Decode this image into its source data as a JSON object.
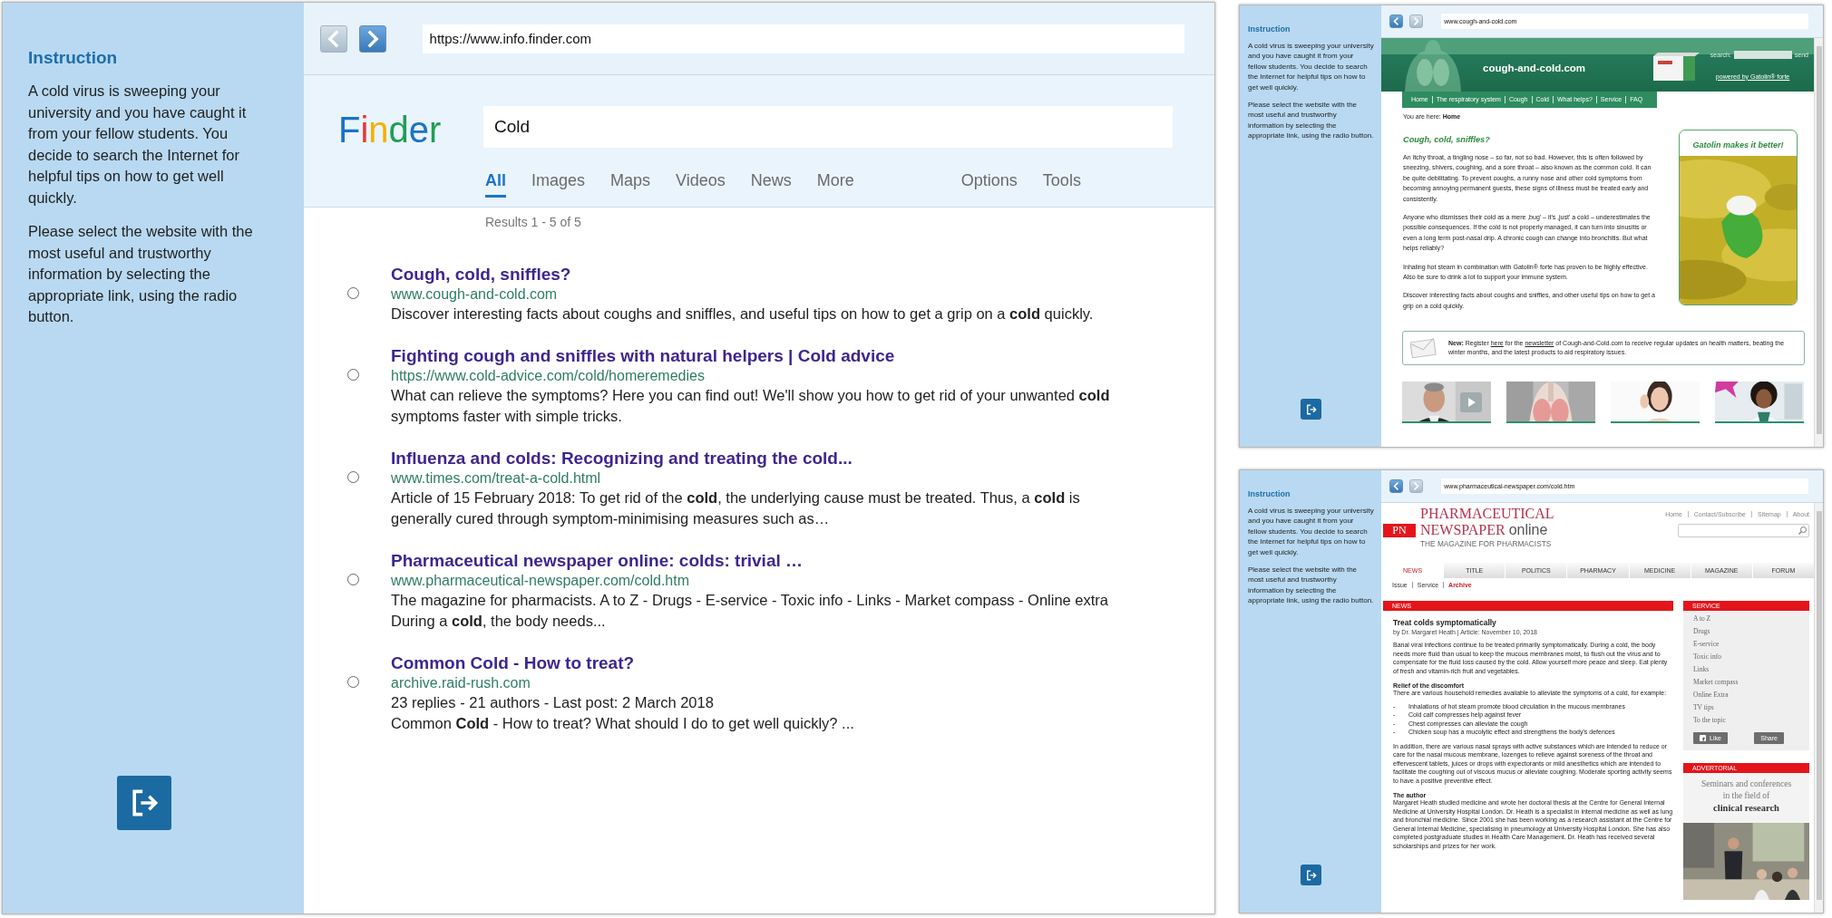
{
  "screens": [
    {
      "kind": "search",
      "instruction": {
        "title": "Instruction",
        "paragraphs": [
          "A cold virus is sweeping your university and you have caught it from your fellow students. You decide to search the Internet for helpful tips on how to get well quickly.",
          "Please select the website with the most useful and trustworthy information by selecting the appropriate link, using the radio button."
        ]
      },
      "back": {
        "disabled": true
      },
      "forward": {
        "disabled": false
      },
      "url": "https://www.info.finder.com",
      "page": {
        "logo": "Finder",
        "query": "Cold",
        "tabs": [
          {
            "label": "All",
            "selected": true
          },
          {
            "label": "Images",
            "selected": false
          },
          {
            "label": "Maps",
            "selected": false
          },
          {
            "label": "Videos",
            "selected": false
          },
          {
            "label": "News",
            "selected": false
          },
          {
            "label": "More",
            "selected": false
          }
        ],
        "options": [
          "Options",
          "Tools"
        ],
        "results_count": "Results 1 - 5 of 5",
        "results": [
          {
            "title": "Cough, cold, sniffles?",
            "url": "www.cough-and-cold.com",
            "snippet": [
              "Discover interesting facts about coughs and sniffles, and useful tips on how to get a grip on a **cold** quickly."
            ],
            "selected": false
          },
          {
            "title": "Fighting cough and sniffles with natural helpers | Cold advice",
            "url": "https://www.cold-advice.com/cold/homeremedies",
            "snippet": [
              "What can relieve the symptoms? Here you can find out! We'll show you how to get rid of your unwanted **cold**",
              "symptoms faster with simple tricks."
            ],
            "selected": false
          },
          {
            "title": "Influenza and colds: Recognizing and treating the cold...",
            "url": "www.times.com/treat-a-cold.html",
            "snippet": [
              "Article of 15 February 2018: To get rid of the **cold**, the underlying cause must be treated. Thus, a **cold** is",
              "generally cured through symptom-minimising measures such as…"
            ],
            "selected": false
          },
          {
            "title": "Pharmaceutical newspaper online: colds: trivial …",
            "url": "www.pharmaceutical-newspaper.com/cold.htm",
            "snippet": [
              "The magazine for pharmacists. A to Z - Drugs - E-service - Toxic info - Links - Market compass -  Online extra",
              "During a **cold**, the body needs..."
            ],
            "selected": false
          },
          {
            "title": "Common Cold - How to treat?",
            "url": "archive.raid-rush.com",
            "snippet": [
              "23 replies - 21 authors - Last post: 2 March 2018",
              "Common **Cold** - How to treat? What should I do to get well quickly? ..."
            ],
            "selected": false
          }
        ]
      }
    },
    {
      "kind": "cough_site",
      "instruction": {
        "title": "Instruction",
        "paragraphs": [
          "A cold virus is sweeping your university and you have caught it from your fellow students. You decide to search the Internet for helpful tips on how to get well quickly.",
          "Please select the website with the most useful and trustworthy information by selecting the appropriate link, using the radio button."
        ]
      },
      "back": {
        "disabled": false
      },
      "forward": {
        "disabled": true
      },
      "url": "www.cough-and-cold.com",
      "page": {
        "site_name": "cough-and-cold.com",
        "search_label": "search:",
        "send": "send",
        "powered_by": "powered by Gatolin® forte",
        "nav": [
          "Home",
          "The respiratory system",
          "Cough",
          "Cold",
          "What helps?",
          "Service",
          "FAQ"
        ],
        "breadcrumb": "You are here: **Home**",
        "heading": "Cough, cold, sniffles?",
        "paragraphs": [
          "An itchy throat, a tingling nose – so far, not so bad. However, this is often followed by sneezing, shivers, coughing, and a sore throat – also known as the common cold. It can be quite debilitating. To prevent coughs, a runny nose and other cold symptoms from becoming annoying permanent guests, these signs of illness must be treated early and consistently.",
          "Anyone who dismisses their cold as a mere ‚bug' – it's ‚just' a cold – underestimates the possible consequences. If the cold is not properly managed, it can turn into sinusitis or even a long term post-nasal drip. A chronic cough can change into bronchitis. But what helps reliably?",
          "Inhaling hot steam in combination with Gatolin® forte has proven to be highly effective. Also be sure to drink a lot to support your immune system.",
          "Discover interesting facts about coughs and sniffles, and other useful tips on how to get a grip on a cold quickly."
        ],
        "promo": {
          "title": "Gatolin makes it better!"
        },
        "newsletter": [
          {
            "kind": "text",
            "text": "**New:** Register "
          },
          {
            "kind": "link",
            "text": "here"
          },
          {
            "kind": "text",
            "text": " for the "
          },
          {
            "kind": "link",
            "text": "newsletter"
          },
          {
            "kind": "text",
            "text": " of Cough-and-Cold.com to receive regular updates on health matters, beating the winter months, and the latest products to aid respiratory issues."
          }
        ],
        "thumbnails": [
          {
            "kind": "picture",
            "video": true
          },
          {
            "kind": "picture",
            "video": false
          },
          {
            "kind": "picture",
            "video": false
          },
          {
            "kind": "picture",
            "video": false
          }
        ]
      }
    },
    {
      "kind": "pharma_site",
      "instruction": {
        "title": "Instruction",
        "paragraphs": [
          "A cold virus is sweeping your university and you have caught it from your fellow students. You decide to search the Internet for helpful tips on how to get well quickly.",
          "Please select the website with the most useful and trustworthy information by selecting the appropriate link, using the radio button."
        ]
      },
      "back": {
        "disabled": false
      },
      "forward": {
        "disabled": true
      },
      "url": "www.pharmaceutical-newspaper.com/cold.htm",
      "page": {
        "logo": {
          "badge": "PN",
          "line1": "PHARMACEUTICAL",
          "line2": "NEWSPAPER",
          "suffix": "online",
          "tagline": "THE MAGAZINE FOR PHARMACISTS"
        },
        "top_links": [
          "Home",
          "Contact/Subscribe",
          "Sitemap",
          "About"
        ],
        "tabs": [
          {
            "label": "NEWS",
            "selected": true
          },
          {
            "label": "TITLE",
            "selected": false
          },
          {
            "label": "POLITICS",
            "selected": false
          },
          {
            "label": "PHARMACY",
            "selected": false
          },
          {
            "label": "MEDICINE",
            "selected": false
          },
          {
            "label": "MAGAZINE",
            "selected": false
          },
          {
            "label": "FORUM",
            "selected": false
          }
        ],
        "subnav": [
          {
            "label": "Issue",
            "selected": false
          },
          {
            "label": "Service",
            "selected": false
          },
          {
            "label": "Archive",
            "selected": true
          }
        ],
        "section": "NEWS",
        "article": {
          "title": "Treat colds symptomatically",
          "byline": "by Dr. Margaret Heath | Article: November 10, 2018",
          "blocks": [
            {
              "kind": "paragraph",
              "text": "Banal viral infections continue to be treated primarily symptomatically. During a cold, the body needs more fluid than usual to keep the mucous membranes moist, to flush out the virus and to compensate for the fluid loss caused by the cold. Allow yourself more peace and sleep. Eat plenty of fresh and vitamin-rich fruit and vegetables."
            },
            {
              "kind": "heading",
              "text": "Relief of the discomfort"
            },
            {
              "kind": "paragraph",
              "text": "There are various household remedies available to alleviate the symptoms of a cold, for example:"
            },
            {
              "kind": "list",
              "marker": "-",
              "items": [
                "Inhalations of hot steam promote blood circulation in the mucous membranes",
                "Cold calf compresses help against fever",
                "Chest compresses can alleviate the cough",
                "Chicken soup has a mucolytic effect and strengthens the body's defences"
              ]
            },
            {
              "kind": "paragraph",
              "text": "In addition, there are various nasal sprays with active substances which are intended to reduce or care for the nasal mucous membrane, lozenges to relieve against soreness of the throat and effervescent tablets, juices or drops with expectorants or mild anesthetics which are intended to facilitate the coughing out of viscous mucus or alleviate coughing. Moderate sporting activity seems to have a positive preventive effect."
            },
            {
              "kind": "heading",
              "text": "The author"
            },
            {
              "kind": "paragraph",
              "text": "Margaret Heath studied medicine and wrote her doctoral thesis at the Centre for General Internal Medicine at University Hospital London. Dr. Heath is a specialist in internal medicine as well as lung and bronchial medicine. Since 2001 she has been working as a research assistant at the Centre for General Internal Medicine, specialising in pneumology at University Hospital London. She has also completed postgraduate studies in Health Care Management. Dr. Heath has received several scholarships and prizes for her work."
            }
          ]
        },
        "service": {
          "title": "SERVICE",
          "items": [
            "A to Z",
            "Drugs",
            "E-service",
            "Toxic info",
            "Links",
            "Market compass",
            "Online Extra",
            "TV tips",
            "To the topic"
          ],
          "like": "Like",
          "share": "Share"
        },
        "advertorial": {
          "title": "ADVERTORIAL",
          "lines": [
            "Seminars and conferences",
            "in the field of",
            "**clinical research**"
          ]
        }
      }
    }
  ]
}
